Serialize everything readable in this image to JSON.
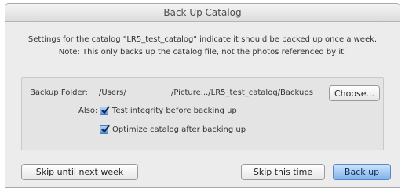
{
  "window": {
    "title": "Back Up Catalog"
  },
  "description": {
    "line1": "Settings for the catalog \"LR5_test_catalog\" indicate it should be backed up once a week.",
    "line2": "Note: This only backs up the catalog file, not the photos referenced by it."
  },
  "backup_folder": {
    "label": "Backup Folder:",
    "path_start": "/Users/",
    "path_end": "/Picture.../LR5_test_catalog/Backups",
    "choose_label": "Choose..."
  },
  "also": {
    "label": "Also:",
    "options": [
      {
        "label": "Test integrity before backing up",
        "checked": true
      },
      {
        "label": "Optimize catalog after backing up",
        "checked": true
      }
    ]
  },
  "buttons": {
    "skip_week": "Skip until next week",
    "skip_time": "Skip this time",
    "back_up": "Back up"
  },
  "colors": {
    "primary_button": "#7fb2ec",
    "checkbox": "#5b93da"
  }
}
